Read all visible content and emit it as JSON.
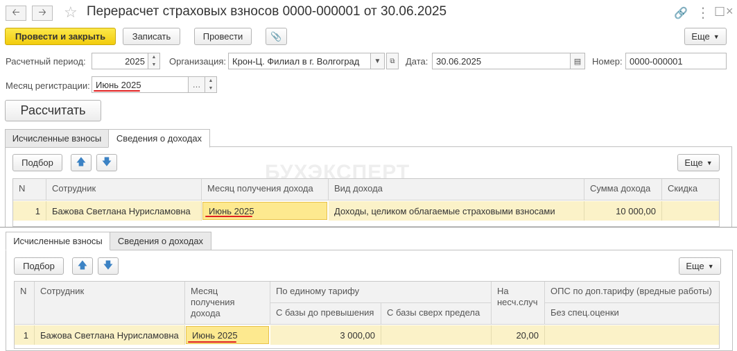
{
  "title": "Перерасчет страховых взносов 0000-000001 от 30.06.2025",
  "toolbar": {
    "post_close": "Провести и закрыть",
    "save": "Записать",
    "post": "Провести",
    "more": "Еще"
  },
  "header": {
    "period_label": "Расчетный период:",
    "period_value": "2025",
    "org_label": "Организация:",
    "org_value": "Крон-Ц. Филиал в г. Волгоград",
    "date_label": "Дата:",
    "date_value": "30.06.2025",
    "number_label": "Номер:",
    "number_value": "0000-000001",
    "reg_month_label": "Месяц регистрации:",
    "reg_month_value": "Июнь 2025",
    "calculate": "Рассчитать"
  },
  "watermark": "БУХЭКСПЕРТ",
  "top": {
    "tabs": [
      "Исчисленные взносы",
      "Сведения о доходах"
    ],
    "active_tab": 1,
    "select": "Подбор",
    "more": "Еще",
    "columns": [
      "N",
      "Сотрудник",
      "Месяц получения дохода",
      "Вид дохода",
      "Сумма дохода",
      "Скидка"
    ],
    "rows": [
      [
        "1",
        "Бажова Светлана Нурисламовна",
        "Июнь 2025",
        "Доходы, целиком облагаемые страховыми взносами",
        "10 000,00",
        ""
      ]
    ]
  },
  "bottom": {
    "tabs": [
      "Исчисленные взносы",
      "Сведения о доходах"
    ],
    "active_tab": 0,
    "select": "Подбор",
    "more": "Еще",
    "columns": {
      "n": "N",
      "employee": "Сотрудник",
      "month": "Месяц получения дохода",
      "single_tariff": "По единому тарифу",
      "base_below": "С базы до превышения",
      "base_above": "С базы сверх предела",
      "accident": "На несч.случ",
      "ops_extra": "ОПС по доп.тарифу (вредные работы)",
      "no_special": "Без спец.оценки"
    },
    "rows": [
      {
        "n": "1",
        "employee": "Бажова Светлана Нурисламовна",
        "month": "Июнь 2025",
        "base_below": "3 000,00",
        "base_above": "",
        "accident": "20,00",
        "no_special": ""
      }
    ]
  },
  "colors": {
    "accent": "#f2cc0d",
    "highlight": "#fbf2c8",
    "underline": "#e02020"
  }
}
